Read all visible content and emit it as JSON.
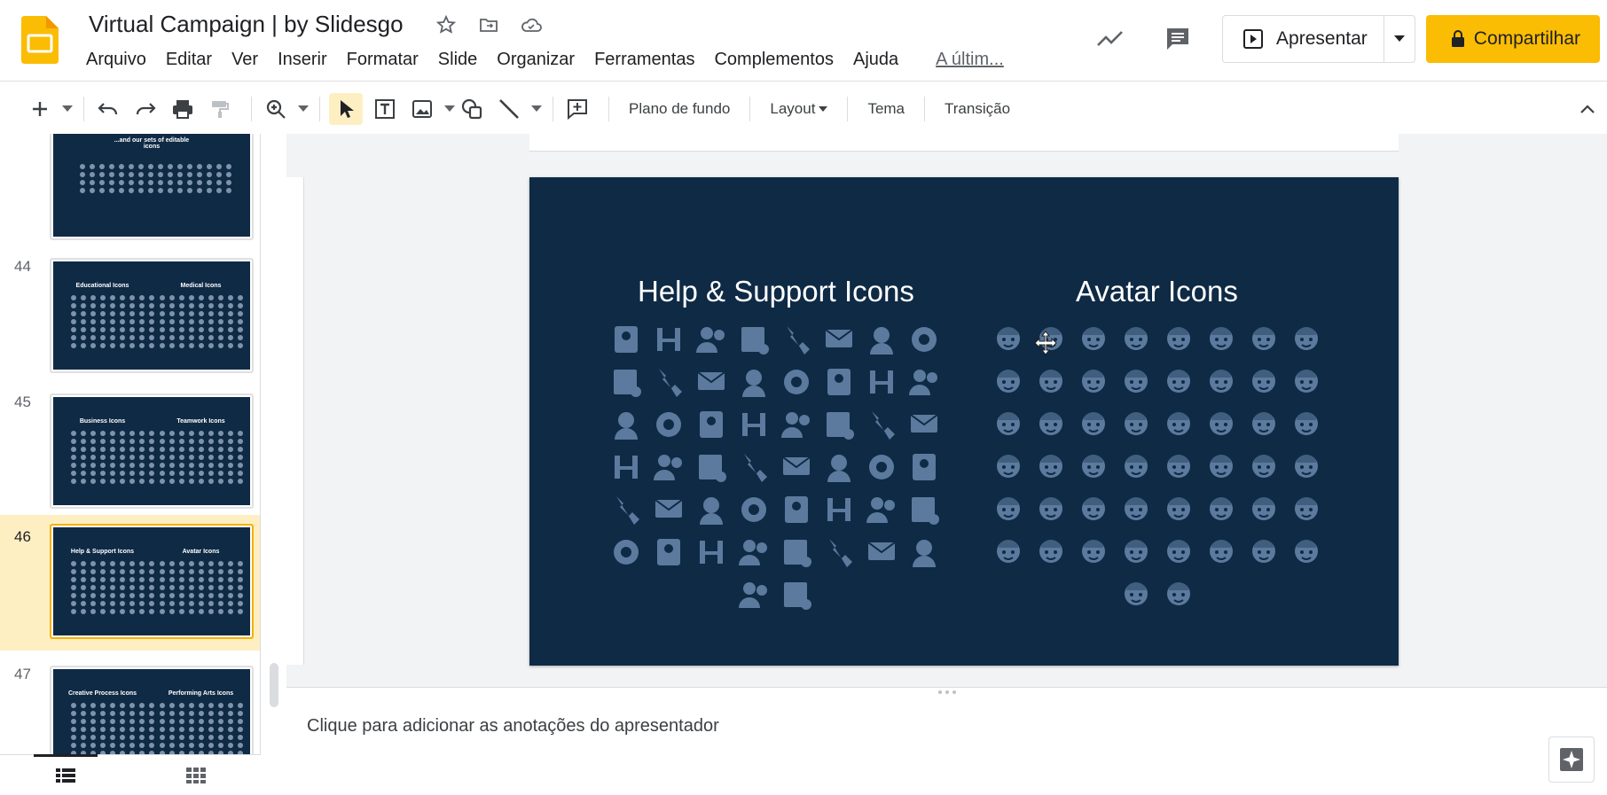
{
  "doc": {
    "title": "Virtual Campaign | by Slidesgo"
  },
  "menu": [
    "Arquivo",
    "Editar",
    "Ver",
    "Inserir",
    "Formatar",
    "Slide",
    "Organizar",
    "Ferramentas",
    "Complementos",
    "Ajuda"
  ],
  "last_edit": "A últim...",
  "header": {
    "present_label": "Apresentar",
    "share_label": "Compartilhar"
  },
  "toolbar": {
    "background": "Plano de fundo",
    "layout": "Layout",
    "theme": "Tema",
    "transition": "Transição"
  },
  "filmstrip": [
    {
      "num": "",
      "left_title": "...and our sets of editable icons",
      "right_title": ""
    },
    {
      "num": "44",
      "left_title": "Educational Icons",
      "right_title": "Medical Icons"
    },
    {
      "num": "45",
      "left_title": "Business Icons",
      "right_title": "Teamwork Icons"
    },
    {
      "num": "46",
      "left_title": "Help & Support Icons",
      "right_title": "Avatar Icons",
      "selected": true
    },
    {
      "num": "47",
      "left_title": "Creative Process Icons",
      "right_title": "Performing Arts Icons"
    }
  ],
  "slide": {
    "left_heading": "Help & Support Icons",
    "right_heading": "Avatar Icons",
    "help_icon_rows": [
      8,
      8,
      8,
      8,
      8,
      8,
      2
    ],
    "avatar_icon_rows": [
      8,
      8,
      8,
      8,
      8,
      8,
      2
    ],
    "icon_color": "#5b7a9d",
    "background": "#0f2a45"
  },
  "notes": {
    "placeholder": "Clique para adicionar as anotações do apresentador"
  },
  "colors": {
    "accent": "#fbbc04",
    "selected_bg": "#feefc3"
  }
}
